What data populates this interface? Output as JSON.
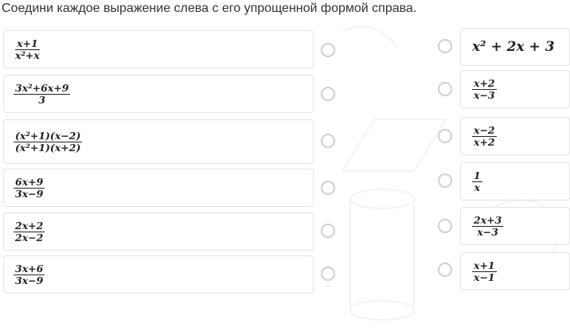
{
  "question": "Соедини каждое выражение слева с его упрощенной формой справа.",
  "left_items": [
    {
      "num": "x+1",
      "den": "x²+x"
    },
    {
      "num": "3x²+6x+9",
      "den": "3"
    },
    {
      "num": "(x²+1)(x−2)",
      "den": "(x²+1)(x+2)"
    },
    {
      "num": "6x+9",
      "den": "3x−9"
    },
    {
      "num": "2x+2",
      "den": "2x−2"
    },
    {
      "num": "3x+6",
      "den": "3x−9"
    }
  ],
  "right_items": [
    {
      "expr": "x² + 2x + 3"
    },
    {
      "num": "x+2",
      "den": "x−3"
    },
    {
      "num": "x−2",
      "den": "x+2"
    },
    {
      "num": "1",
      "den": "x"
    },
    {
      "num": "2x+3",
      "den": "x−3"
    },
    {
      "num": "x+1",
      "den": "x−1"
    }
  ],
  "colors": {
    "card_border": "#e3e3e3",
    "radio_border": "#cfcfcf",
    "text": "#222222"
  }
}
